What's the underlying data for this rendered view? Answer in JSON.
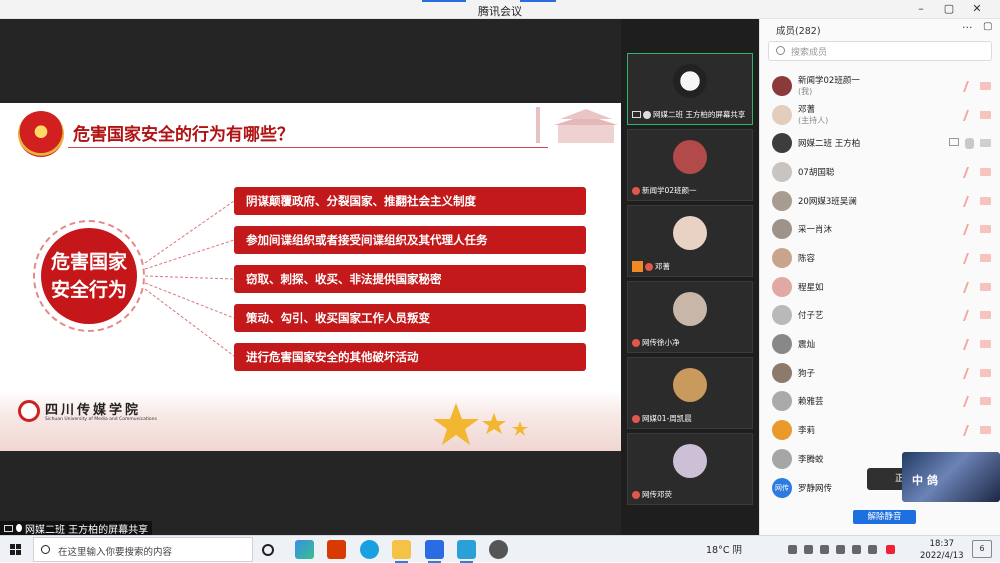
{
  "window": {
    "title": "腾讯会议",
    "controls": [
      "–",
      "▢",
      "✕"
    ]
  },
  "slide": {
    "title": "危害国家安全的行为有哪些？",
    "center_label": "危害国家安全行为",
    "items": [
      "阴谋颠覆政府、分裂国家、推翻社会主义制度",
      "参加间谍组织或者接受间谍组织及其代理人任务",
      "窃取、刺探、收买、非法提供国家秘密",
      "策动、勾引、收买国家工作人员叛变",
      "进行危害国家安全的其他破坏活动"
    ],
    "school_name": "四川传媒学院",
    "school_en": "Sichuan University of Media and Communications"
  },
  "sharer_label": "网媒二班 王方柏的屏幕共享",
  "thumbnails": [
    {
      "name": "网媒二班 王方柏的屏幕共享",
      "avatar_color": "#d9d9d9",
      "active": true
    },
    {
      "name": "新闻学02班颜一",
      "avatar_color": "#b24a4a",
      "active": false
    },
    {
      "name": "邓蓍",
      "avatar_color": "#e8d2c3",
      "active": false
    },
    {
      "name": "网传徐小净",
      "avatar_color": "#c8b7a8",
      "active": false
    },
    {
      "name": "网媒01-周凯晨",
      "avatar_color": "#c99a5d",
      "active": false
    },
    {
      "name": "网传邓荧",
      "avatar_color": "#cdbfd6",
      "active": false
    }
  ],
  "members": {
    "title": "成员(282)",
    "search_placeholder": "搜索成员",
    "list": [
      {
        "name": "新闻学02班颜一",
        "sub": "(我)",
        "avatar_color": "#8b3a3a"
      },
      {
        "name": "邓蓍",
        "sub": "(主持人)",
        "avatar_color": "#e3cdbd"
      },
      {
        "name": "网媒二班 王方柏",
        "sub": "",
        "avatar_color": "#3d3d3d"
      },
      {
        "name": "07胡国聪",
        "sub": "",
        "avatar_color": "#c9c4c0"
      },
      {
        "name": "20网媒3班吴澜",
        "sub": "",
        "avatar_color": "#a89b90"
      },
      {
        "name": "采一肖沐",
        "sub": "",
        "avatar_color": "#9e938a"
      },
      {
        "name": "陈容",
        "sub": "",
        "avatar_color": "#c7a48a"
      },
      {
        "name": "程星如",
        "sub": "",
        "avatar_color": "#e0a9a3"
      },
      {
        "name": "付子艺",
        "sub": "",
        "avatar_color": "#b9b9b9"
      },
      {
        "name": "震灿",
        "sub": "",
        "avatar_color": "#888888"
      },
      {
        "name": "狗子",
        "sub": "",
        "avatar_color": "#8d7a6b"
      },
      {
        "name": "赖雅芸",
        "sub": "",
        "avatar_color": "#aaaaaa"
      },
      {
        "name": "李莉",
        "sub": "",
        "avatar_color": "#e99a2b"
      },
      {
        "name": "李腾蛟",
        "sub": "",
        "avatar_color": "#a6a6a6"
      },
      {
        "name": "罗静网传",
        "sub": "",
        "avatar_color": "#2d7be0",
        "avatar_text": "网传"
      }
    ],
    "unmute_all_label": "解除静音",
    "toast_text": "正",
    "game_overlay_text": "中 鸽"
  },
  "taskbar": {
    "search_placeholder": "在这里输入你要搜索的内容",
    "weather": "18°C 阴",
    "time": "18:37",
    "date": "2022/4/13",
    "notify": "6"
  },
  "colors": {
    "accent_blue": "#1e6fe0",
    "slide_red": "#c4191b",
    "active_green": "#2fb36d"
  }
}
